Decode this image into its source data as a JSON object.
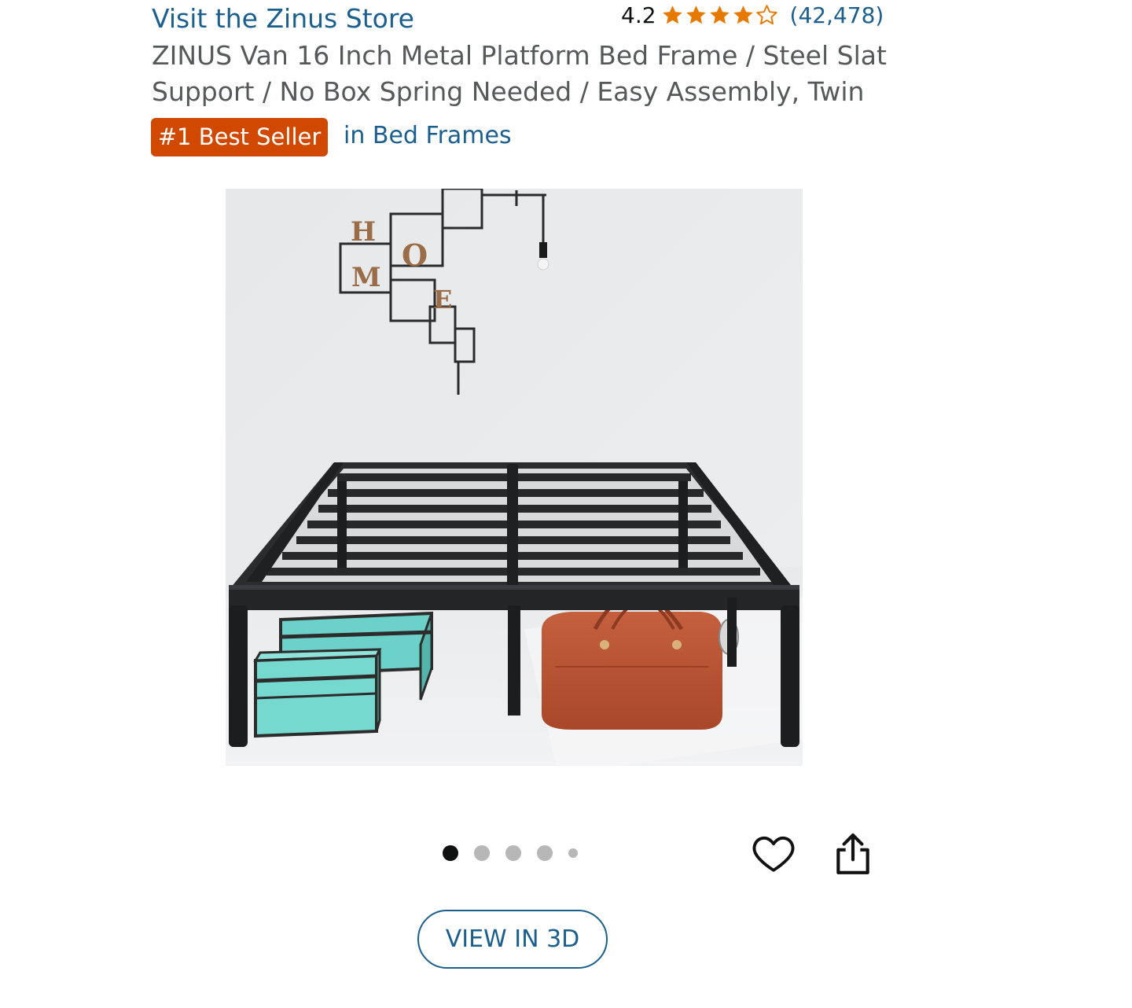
{
  "store_link": "Visit the Zinus Store",
  "rating": {
    "value": "4.2",
    "stars_filled": 4,
    "stars_total": 5,
    "review_count": "(42,478)"
  },
  "title": "ZINUS Van 16 Inch Metal Platform Bed Frame / Steel Slat Support / No Box Spring Needed / Easy Assembly, Twin",
  "badge": "#1 Best Seller",
  "category": "in Bed Frames",
  "image": {
    "wall_decor_letters": [
      "H",
      "O",
      "M",
      "E"
    ]
  },
  "carousel": {
    "total": 5,
    "active_index": 0
  },
  "view_3d_label": "VIEW IN 3D",
  "colors": {
    "link": "#1a5f8e",
    "star": "#e67a00",
    "badge": "#d14900",
    "title": "#565959"
  },
  "icons": {
    "wishlist": "heart-outline-icon",
    "share": "share-icon"
  }
}
